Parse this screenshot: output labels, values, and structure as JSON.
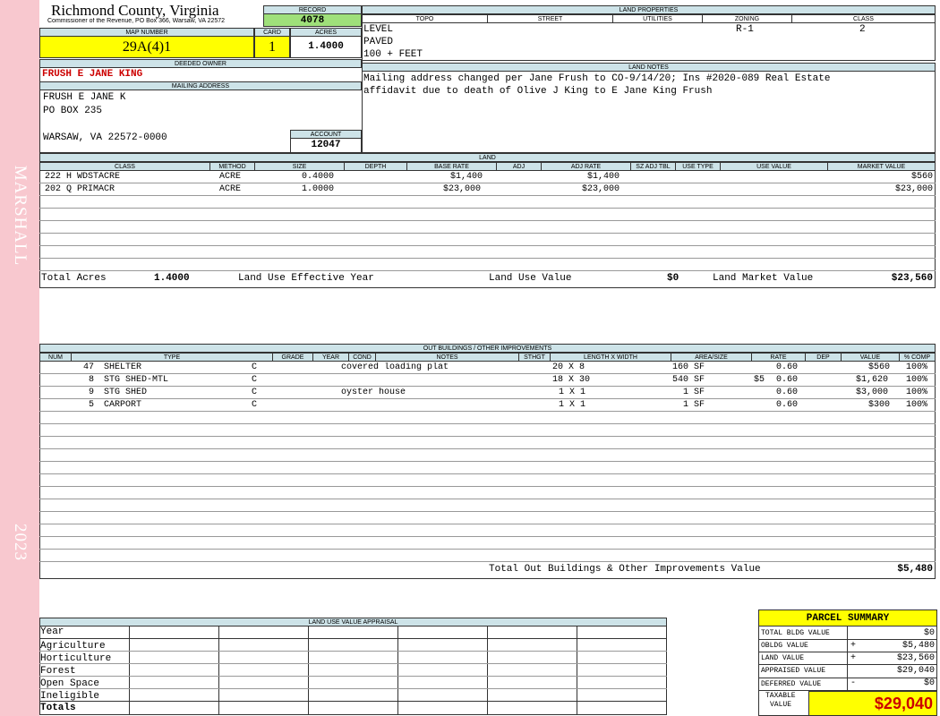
{
  "sidebar": {
    "district": "MARSHALL",
    "year": "2023"
  },
  "header": {
    "county": "Richmond County, Virginia",
    "commissioner": "Commissioner of the Revenue, PO Box 366, Warsaw, VA 22572",
    "record_label": "RECORD",
    "record_value": "4078",
    "map_label": "MAP NUMBER",
    "map_value": "29A(4)1",
    "card_label": "CARD",
    "card_value": "1",
    "acres_label": "ACRES",
    "acres_value": "1.4000"
  },
  "land_properties": {
    "title": "LAND PROPERTIES",
    "cols": [
      "TOPO",
      "STREET",
      "UTILITIES",
      "ZONING",
      "CLASS"
    ],
    "topo": [
      "LEVEL",
      "PAVED",
      "100 + FEET"
    ],
    "zoning": "R-1",
    "class": "2"
  },
  "owner": {
    "deeded_label": "DEEDED OWNER",
    "deeded_value": "FRUSH E JANE KING",
    "mailing_label": "MAILING ADDRESS",
    "mailing_lines": [
      "FRUSH E JANE K",
      "PO BOX 235",
      "",
      "WARSAW, VA 22572-0000"
    ],
    "account_label": "ACCOUNT",
    "account_value": "12047"
  },
  "land_notes": {
    "title": "LAND NOTES",
    "lines": [
      "Mailing address changed per Jane Frush to CO-9/14/20; Ins #2020-089 Real Estate",
      "affidavit due to death of Olive J King to E Jane King Frush"
    ]
  },
  "land": {
    "title": "LAND",
    "cols": [
      "CLASS",
      "METHOD",
      "SIZE",
      "DEPTH",
      "BASE RATE",
      "ADJ",
      "ADJ RATE",
      "SZ ADJ TBL",
      "USE TYPE",
      "USE VALUE",
      "MARKET VALUE"
    ],
    "rows": [
      {
        "class": "222 H WDSTACRE",
        "method": "ACRE",
        "size": "0.4000",
        "base_rate": "$1,400",
        "adj_rate": "$1,400",
        "market": "$560"
      },
      {
        "class": "202 Q PRIMACR",
        "method": "ACRE",
        "size": "1.0000",
        "base_rate": "$23,000",
        "adj_rate": "$23,000",
        "market": "$23,000"
      }
    ],
    "total_acres_label": "Total Acres",
    "total_acres": "1.4000",
    "use_year_label": "Land Use Effective Year",
    "use_value_label": "Land Use Value",
    "use_value": "$0",
    "market_label": "Land Market Value",
    "market_value": "$23,560"
  },
  "outbuildings": {
    "title": "OUT BUILDINGS / OTHER IMPROVEMENTS",
    "cols": [
      "NUM",
      "TYPE",
      "GRADE",
      "YEAR",
      "COND",
      "NOTES",
      "STHGT",
      "LENGTH X WIDTH",
      "AREA/SIZE",
      "RATE",
      "DEP",
      "VALUE",
      "% COMP"
    ],
    "rows": [
      {
        "num": "47",
        "type": "SHELTER",
        "grade": "C",
        "notes": "covered loading plat",
        "lxw": "20 X 8",
        "area": "160 SF",
        "rate": "",
        "dep": "0.60",
        "value": "$560",
        "comp": "100%"
      },
      {
        "num": "8",
        "type": "STG SHED-MTL",
        "grade": "C",
        "notes": "",
        "lxw": "18 X 30",
        "area": "540 SF",
        "rate": "$5",
        "dep": "0.60",
        "value": "$1,620",
        "comp": "100%"
      },
      {
        "num": "9",
        "type": "STG SHED",
        "grade": "C",
        "notes": "oyster house",
        "lxw": "1 X 1",
        "area": "1 SF",
        "rate": "",
        "dep": "0.60",
        "value": "$3,000",
        "comp": "100%"
      },
      {
        "num": "5",
        "type": "CARPORT",
        "grade": "C",
        "notes": "",
        "lxw": "1 X 1",
        "area": "1 SF",
        "rate": "",
        "dep": "0.60",
        "value": "$300",
        "comp": "100%"
      }
    ],
    "total_label": "Total Out Buildings & Other Improvements Value",
    "total_value": "$5,480"
  },
  "land_use": {
    "title": "LAND USE VALUE APPRAISAL",
    "rows": [
      "Year",
      "Agriculture",
      "Horticulture",
      "Forest",
      "Open Space",
      "Ineligible",
      "Totals"
    ]
  },
  "summary": {
    "title": "PARCEL SUMMARY",
    "rows": [
      {
        "label": "TOTAL BLDG VALUE",
        "op": "",
        "value": "$0"
      },
      {
        "label": "OBLDG VALUE",
        "op": "+",
        "value": "$5,480"
      },
      {
        "label": "LAND VALUE",
        "op": "+",
        "value": "$23,560"
      },
      {
        "label": "APPRAISED VALUE",
        "op": "",
        "value": "$29,040"
      },
      {
        "label": "DEFERRED VALUE",
        "op": "-",
        "value": "$0"
      }
    ],
    "taxable_label_1": "TAXABLE",
    "taxable_label_2": "VALUE",
    "taxable_value": "$29,040"
  },
  "colors": {
    "sidebar": "#f8c8cf",
    "header_bg": "#cde3e8",
    "highlight": "#ffff00",
    "record_bg": "#9fe07a",
    "red": "#cc0000"
  }
}
